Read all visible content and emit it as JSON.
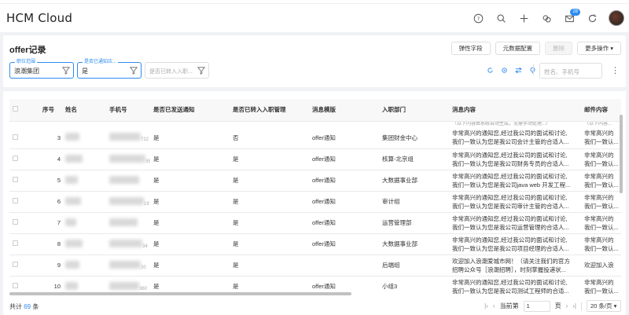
{
  "app": {
    "title": "HCM Cloud",
    "notification_count": "28"
  },
  "header_icons": [
    "help-icon",
    "search-icon",
    "plus-icon",
    "org-icon",
    "mail-icon",
    "refresh-icon"
  ],
  "page": {
    "title": "offer记录",
    "buttons": {
      "elastic_fields": "弹性字段",
      "metadata_config": "元数据配置",
      "delete": "删除",
      "more_actions": "更多操作"
    }
  },
  "filters": [
    {
      "label": "职位范围",
      "value": "浪潮集团"
    },
    {
      "label": "是否已通知应...",
      "value": "是"
    }
  ],
  "filter_placeholder": "是否已转入入职...",
  "search": {
    "placeholder": "姓名、手机号"
  },
  "table": {
    "columns": [
      "序号",
      "姓名",
      "手机号",
      "是否已发送通知",
      "是否已转入入职管理",
      "消息模版",
      "入职部门",
      "消息内容",
      "邮件内容"
    ],
    "top_partial": "（以下内容由系统自动生成，无需手动处理...）",
    "top_partial_mail": "（以下内容...",
    "rows": [
      {
        "no": "3",
        "phone_tail": "722",
        "sent": "是",
        "transferred": "否",
        "template": "offer通知",
        "dept": "集团财金中心",
        "msg1": "非常高兴的通知您,经过我公司的面试和讨论,",
        "msg2": "我们一致认为您是我公司会计主管的合适人...",
        "mail1": "非常高兴的",
        "mail2": "我们一致认..."
      },
      {
        "no": "4",
        "phone_tail": "35",
        "sent": "是",
        "transferred": "是",
        "template": "offer通知",
        "dept": "核算-北京组",
        "msg1": "非常高兴的通知您,经过我公司的面试和讨论,",
        "msg2": "我们一致认为您是我公司财务专员的合适人...",
        "mail1": "非常高兴的",
        "mail2": "我们一致认..."
      },
      {
        "no": "5",
        "phone_tail": "",
        "sent": "是",
        "transferred": "是",
        "template": "offer通知",
        "dept": "大数据事业部",
        "msg1": "非常高兴的通知您,经过我公司的面试和讨论,",
        "msg2": "我们一致认为您是我公司java web 开发工程...",
        "mail1": "非常高兴的",
        "mail2": "我们一致认..."
      },
      {
        "no": "6",
        "phone_tail": "19",
        "sent": "是",
        "transferred": "是",
        "template": "offer通知",
        "dept": "审计组",
        "msg1": "非常高兴的通知您,经过我公司的面试和讨论,",
        "msg2": "我们一致认为您是我公司审计主管的合适人...",
        "mail1": "非常高兴的",
        "mail2": "我们一致认..."
      },
      {
        "no": "7",
        "phone_tail": "",
        "sent": "是",
        "transferred": "是",
        "template": "offer通知",
        "dept": "运营管理部",
        "msg1": "非常高兴的通知您,经过我公司的面试和讨论,",
        "msg2": "我们一致认为您是我公司运营管理的合适人...",
        "mail1": "非常高兴的",
        "mail2": "我们一致认..."
      },
      {
        "no": "8",
        "phone_tail": "34",
        "sent": "是",
        "transferred": "是",
        "template": "offer通知",
        "dept": "大数据事业部",
        "msg1": "非常高兴的通知您,经过我公司的面试和讨论,",
        "msg2": "我们一致认为您是我公司项目经理的合适人...",
        "mail1": "非常高兴的",
        "mail2": "我们一致认..."
      },
      {
        "no": "9",
        "phone_tail": "20",
        "sent": "是",
        "transferred": "是",
        "template": "",
        "dept": "后端组",
        "msg1": "欢迎加入浪潮爱城市网！（请关注我们的官方",
        "msg2": "招聘公众号［浪潮招聘］，时刻掌握投递状...",
        "mail1": "欢迎加入浪",
        "mail2": ""
      },
      {
        "no": "10",
        "phone_tail": "360",
        "sent": "是",
        "transferred": "是",
        "template": "offer通知",
        "dept": "小组3",
        "msg1": "非常高兴的通知您,经过我公司的面试和讨论,",
        "msg2": "我们一致认为您是我公司测试工程师的合适...",
        "mail1": "非常高兴的",
        "mail2": "我们一致认..."
      }
    ]
  },
  "footer": {
    "total_prefix": "共计",
    "total": "69",
    "total_suffix": "条"
  },
  "pager": {
    "current_label": "当前第",
    "current_page": "1",
    "page_suffix": "页",
    "page_size": "20 条/页"
  }
}
